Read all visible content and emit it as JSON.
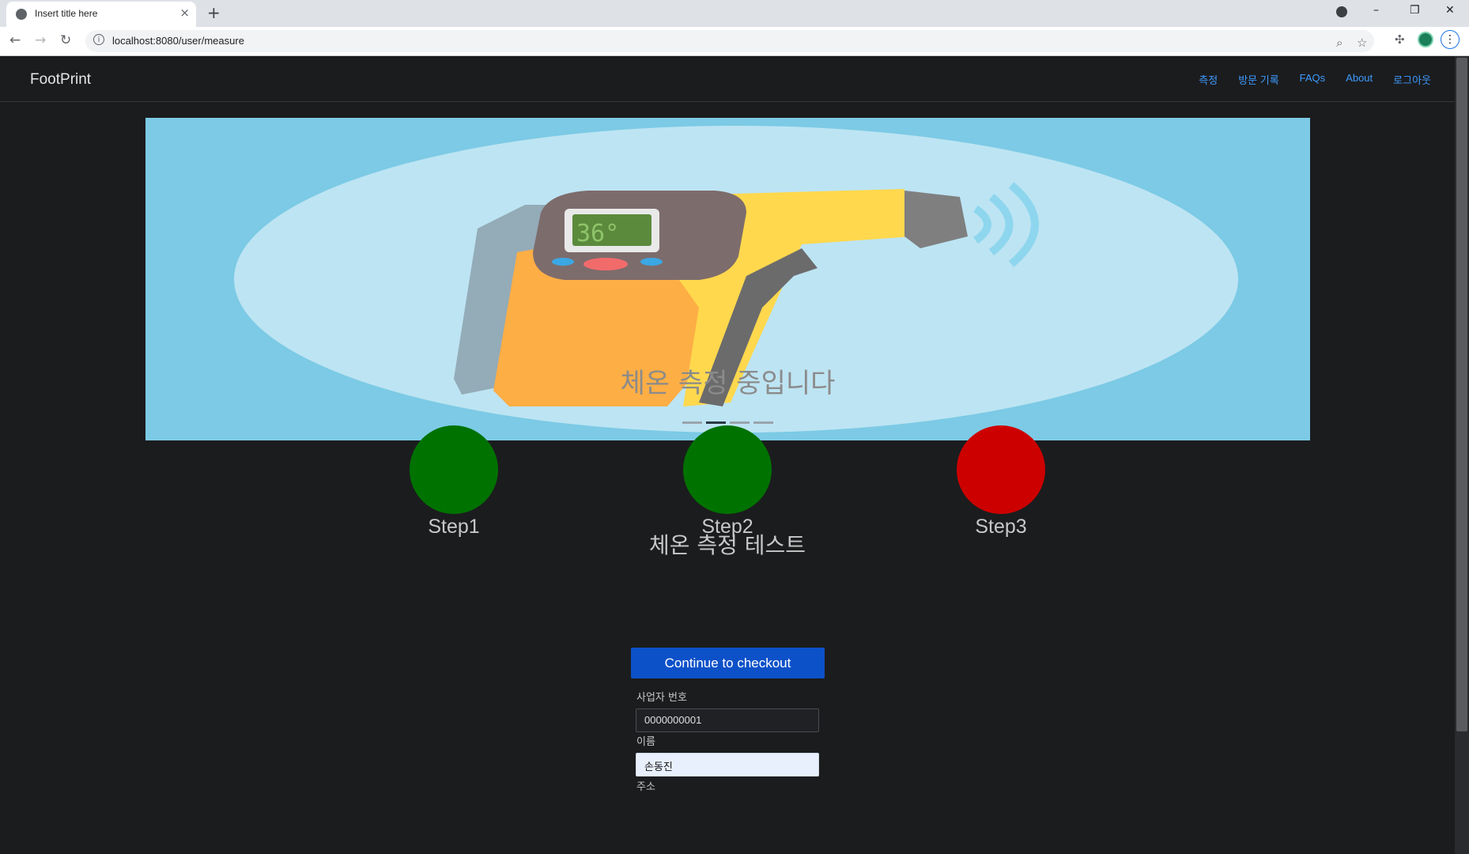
{
  "browser": {
    "tab_title": "Insert title here",
    "tab_close": "×",
    "new_tab": "+",
    "url": "localhost:8080/user/measure",
    "window_controls": [
      "–",
      "❐",
      "✕"
    ]
  },
  "navbar": {
    "brand": "FootPrint",
    "links": [
      "측정",
      "방문 기록",
      "FAQs",
      "About",
      "로그아웃"
    ],
    "link_color": "#3d9bff"
  },
  "carousel": {
    "caption": "체온 측정 중입니다",
    "indicator_count": 4,
    "active_indicator": 2,
    "background_color": "#7ccae5",
    "thermometer_display": "36°"
  },
  "steps": [
    {
      "label": "Step1",
      "color": "#007200"
    },
    {
      "label": "Step2",
      "color": "#007200"
    },
    {
      "label": "Step3",
      "color": "#cd0000"
    }
  ],
  "main": {
    "heading": "체온 측정 테스트",
    "checkout_button": "Continue to checkout",
    "fields": [
      {
        "label": "사업자 번호",
        "value": "0000000001"
      },
      {
        "label": "이름",
        "value": "손동진"
      },
      {
        "label": "주소",
        "value": ""
      }
    ]
  }
}
